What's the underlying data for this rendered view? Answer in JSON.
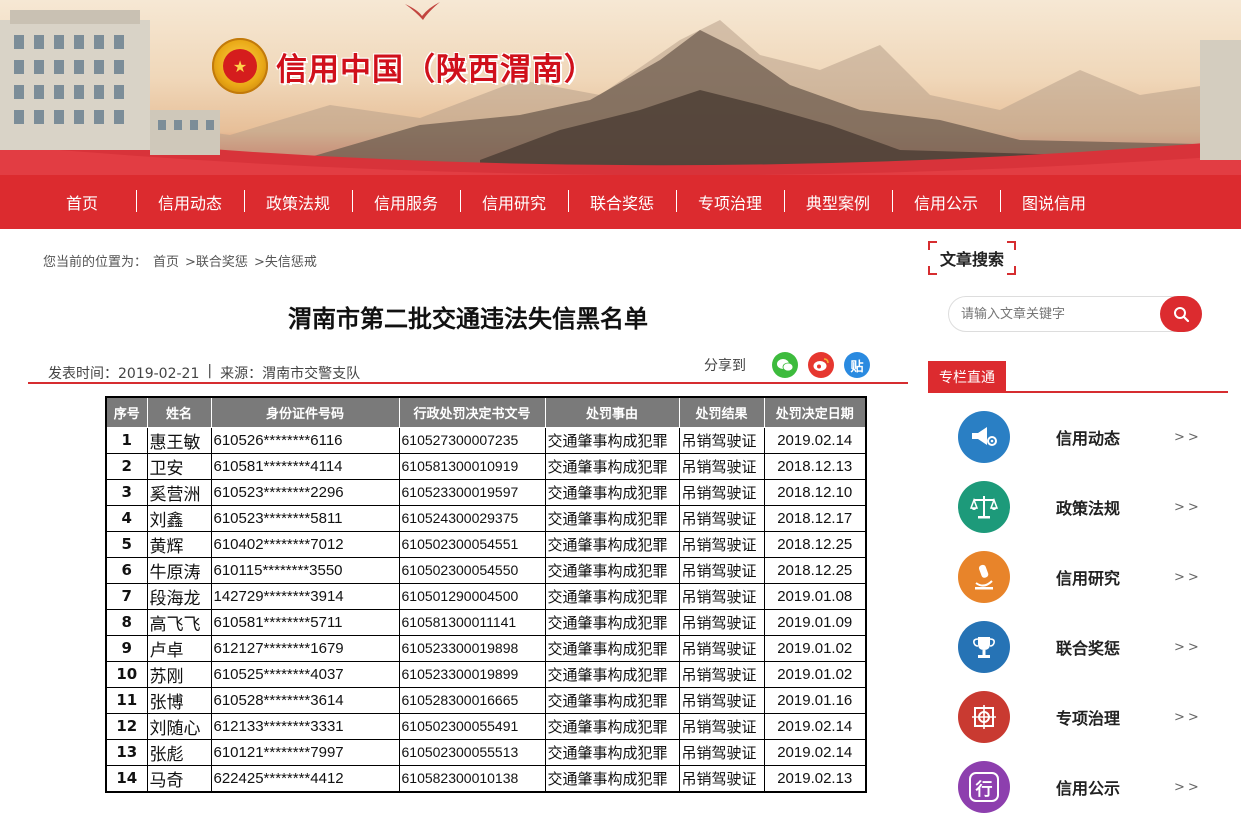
{
  "site": {
    "title": "信用中国（陕西渭南）",
    "emblem_glyph": "★"
  },
  "nav": {
    "items": [
      "首页",
      "信用动态",
      "政策法规",
      "信用服务",
      "信用研究",
      "联合奖惩",
      "专项治理",
      "典型案例",
      "信用公示",
      "图说信用"
    ]
  },
  "breadcrumb": {
    "prefix": "您当前的位置为：",
    "items": [
      "首页",
      ">联合奖惩",
      ">失信惩戒"
    ]
  },
  "article": {
    "title": "渭南市第二批交通违法失信黑名单",
    "publish_label": "发表时间：2019-02-21",
    "separator": "|",
    "source_label": "来源：渭南市交警支队",
    "share_label": "分享到",
    "share_icons": [
      {
        "name": "wechat-icon",
        "glyph": "●",
        "color": "#3dbb3d"
      },
      {
        "name": "weibo-icon",
        "glyph": "●",
        "color": "#e6372f"
      },
      {
        "name": "tieba-icon",
        "glyph": "贴",
        "color": "#2a8ae0"
      }
    ]
  },
  "table": {
    "headers": [
      "序号",
      "姓名",
      "身份证件号码",
      "行政处罚决定书文号",
      "处罚事由",
      "处罚结果",
      "处罚决定日期"
    ],
    "rows": [
      [
        "1",
        "惠王敏",
        "610526********6116",
        "610527300007235",
        "交通肇事构成犯罪",
        "吊销驾驶证",
        "2019.02.14"
      ],
      [
        "2",
        "卫安",
        "610581********4114",
        "610581300010919",
        "交通肇事构成犯罪",
        "吊销驾驶证",
        "2018.12.13"
      ],
      [
        "3",
        "奚营洲",
        "610523********2296",
        "610523300019597",
        "交通肇事构成犯罪",
        "吊销驾驶证",
        "2018.12.10"
      ],
      [
        "4",
        "刘鑫",
        "610523********5811",
        "610524300029375",
        "交通肇事构成犯罪",
        "吊销驾驶证",
        "2018.12.17"
      ],
      [
        "5",
        "黄辉",
        "610402********7012",
        "610502300054551",
        "交通肇事构成犯罪",
        "吊销驾驶证",
        "2018.12.25"
      ],
      [
        "6",
        "牛原涛",
        "610115********3550",
        "610502300054550",
        "交通肇事构成犯罪",
        "吊销驾驶证",
        "2018.12.25"
      ],
      [
        "7",
        "段海龙",
        "142729********3914",
        "610501290004500",
        "交通肇事构成犯罪",
        "吊销驾驶证",
        "2019.01.08"
      ],
      [
        "8",
        "高飞飞",
        "610581********5711",
        "610581300011141",
        "交通肇事构成犯罪",
        "吊销驾驶证",
        "2019.01.09"
      ],
      [
        "9",
        "卢卓",
        "612127********1679",
        "610523300019898",
        "交通肇事构成犯罪",
        "吊销驾驶证",
        "2019.01.02"
      ],
      [
        "10",
        "苏刚",
        "610525********4037",
        "610523300019899",
        "交通肇事构成犯罪",
        "吊销驾驶证",
        "2019.01.02"
      ],
      [
        "11",
        "张博",
        "610528********3614",
        "610528300016665",
        "交通肇事构成犯罪",
        "吊销驾驶证",
        "2019.01.16"
      ],
      [
        "12",
        "刘随心",
        "612133********3331",
        "610502300055491",
        "交通肇事构成犯罪",
        "吊销驾驶证",
        "2019.02.14"
      ],
      [
        "13",
        "张彪",
        "610121********7997",
        "610502300055513",
        "交通肇事构成犯罪",
        "吊销驾驶证",
        "2019.02.14"
      ],
      [
        "14",
        "马奇",
        "622425********4412",
        "610582300010138",
        "交通肇事构成犯罪",
        "吊销驾驶证",
        "2019.02.13"
      ]
    ]
  },
  "sidebar": {
    "search_title": "文章搜索",
    "search_placeholder": "请输入文章关键字",
    "column_title": "专栏直通",
    "arrow": ">>",
    "items": [
      {
        "label": "信用动态",
        "icon": "megaphone-gear-icon",
        "glyph": "◀",
        "color": "#2a7fc4"
      },
      {
        "label": "政策法规",
        "icon": "balance-scale-icon",
        "glyph": "⚖",
        "color": "#1d9a7a"
      },
      {
        "label": "信用研究",
        "icon": "microscope-icon",
        "glyph": "⚗",
        "color": "#e8842a"
      },
      {
        "label": "联合奖惩",
        "icon": "trophy-icon",
        "glyph": "♛",
        "color": "#2673b5"
      },
      {
        "label": "专项治理",
        "icon": "target-icon",
        "glyph": "⊕",
        "color": "#c93a31"
      },
      {
        "label": "信用公示",
        "icon": "seal-icon",
        "glyph": "行",
        "color": "#8d3fae"
      }
    ]
  }
}
